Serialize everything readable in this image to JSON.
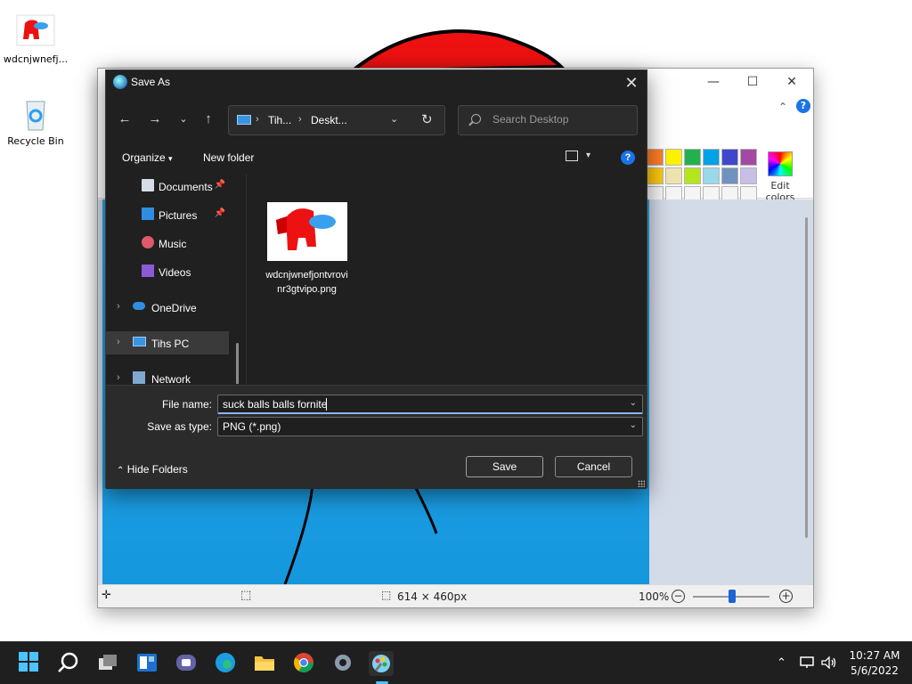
{
  "desktop": {
    "icons": [
      {
        "label": "wdcnjwnefj..."
      },
      {
        "label": "Recycle Bin"
      }
    ]
  },
  "paint": {
    "status": {
      "dimensions": "614 × 460px",
      "zoom": "100%"
    },
    "ribbon": {
      "edit_colors": "Edit colors",
      "palette_row1": [
        "#ff7f27",
        "#fff200",
        "#22b14c",
        "#00a2e8",
        "#3f48cc",
        "#a349a4"
      ],
      "palette_row2": [
        "#ffc90e",
        "#efe4b0",
        "#b5e61d",
        "#99d9ea",
        "#7092be",
        "#c8bfe7"
      ]
    }
  },
  "dialog": {
    "title": "Save As",
    "address": {
      "crumbs": [
        "Tih...",
        "Deskt..."
      ]
    },
    "search_placeholder": "Search Desktop",
    "commands": {
      "organize": "Organize",
      "new_folder": "New folder"
    },
    "nav": [
      {
        "label": "Documents",
        "pinned": true
      },
      {
        "label": "Pictures",
        "pinned": true
      },
      {
        "label": "Music"
      },
      {
        "label": "Videos"
      },
      {
        "label": "OneDrive"
      },
      {
        "label": "Tihs PC",
        "selected": true
      },
      {
        "label": "Network"
      }
    ],
    "file": {
      "name": "wdcnjwnefjontvrovinr3gtvipo.png"
    },
    "file_name_label": "File name:",
    "file_name_value": "suck balls balls fornite",
    "save_type_label": "Save as type:",
    "save_type_value": "PNG (*.png)",
    "hide_folders": "Hide Folders",
    "save_button": "Save",
    "cancel_button": "Cancel"
  },
  "taskbar": {
    "time": "10:27 AM",
    "date": "5/6/2022"
  }
}
